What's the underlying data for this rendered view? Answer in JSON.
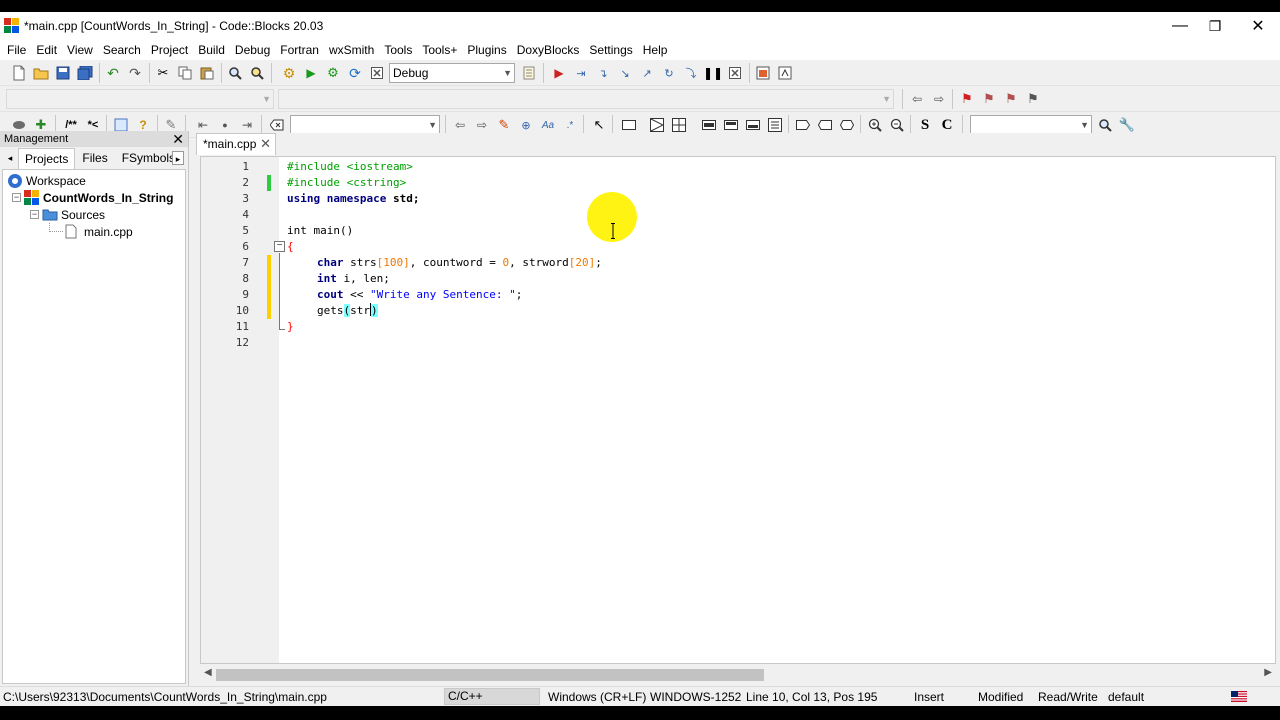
{
  "window": {
    "title": "*main.cpp [CountWords_In_String] - Code::Blocks 20.03",
    "controls": {
      "minimize": "—",
      "maximize": "❐",
      "close": "✕"
    }
  },
  "menu": [
    "File",
    "Edit",
    "View",
    "Search",
    "Project",
    "Build",
    "Debug",
    "Fortran",
    "wxSmith",
    "Tools",
    "Tools+",
    "Plugins",
    "DoxyBlocks",
    "Settings",
    "Help"
  ],
  "toolbar": {
    "build_target": "Debug",
    "doxy_comment": "/**",
    "doxy_line": "*<",
    "symbol_s": "S",
    "symbol_c": "C"
  },
  "management": {
    "title": "Management",
    "close": "✕",
    "tabs": [
      "Projects",
      "Files",
      "FSymbols"
    ],
    "active_tab": "Projects",
    "tree": {
      "workspace": "Workspace",
      "project": "CountWords_In_String",
      "folder": "Sources",
      "file": "main.cpp"
    }
  },
  "editor": {
    "tab_label": "*main.cpp",
    "tab_close": "✕",
    "line_numbers": [
      "1",
      "2",
      "3",
      "4",
      "5",
      "6",
      "7",
      "8",
      "9",
      "10",
      "11",
      "12"
    ],
    "lines": {
      "l1_pp": "#include <iostream>",
      "l2_pp": "#include <cstring>",
      "l3_kw": "using namespace",
      "l3_rest": " std;",
      "l5": "int main()",
      "l6": "{",
      "l7_kw": "char",
      "l7_a": " strs",
      "l7_n1": "[100]",
      "l7_b": ", countword = ",
      "l7_n2": "0",
      "l7_c": ", strword",
      "l7_n3": "[20]",
      "l7_d": ";",
      "l8_kw": "int",
      "l8_rest": " i, len;",
      "l9_kw": "cout",
      "l9_a": " << ",
      "l9_str": "\"Write any Sentence: \"",
      "l9_b": ";",
      "l10_a": "gets",
      "l10_p1": "(",
      "l10_b": "str",
      "l10_p2": ")",
      "l11": "}"
    }
  },
  "status": {
    "path": "C:\\Users\\92313\\Documents\\CountWords_In_String\\main.cpp",
    "language": "C/C++",
    "eol": "Windows (CR+LF)",
    "encoding": "WINDOWS-1252",
    "position": "Line 10, Col 13, Pos 195",
    "mode": "Insert",
    "modified": "Modified",
    "access": "Read/Write",
    "profile": "default"
  },
  "colors": {
    "preprocessor": "#00a000",
    "keyword": "#00007f",
    "number": "#f07800",
    "string": "#0000ff",
    "brace_error": "#ff0000",
    "changed_saved": "#2ecc40",
    "changed_unsaved": "#ffd000",
    "cursor_highlight": "#fff200"
  }
}
